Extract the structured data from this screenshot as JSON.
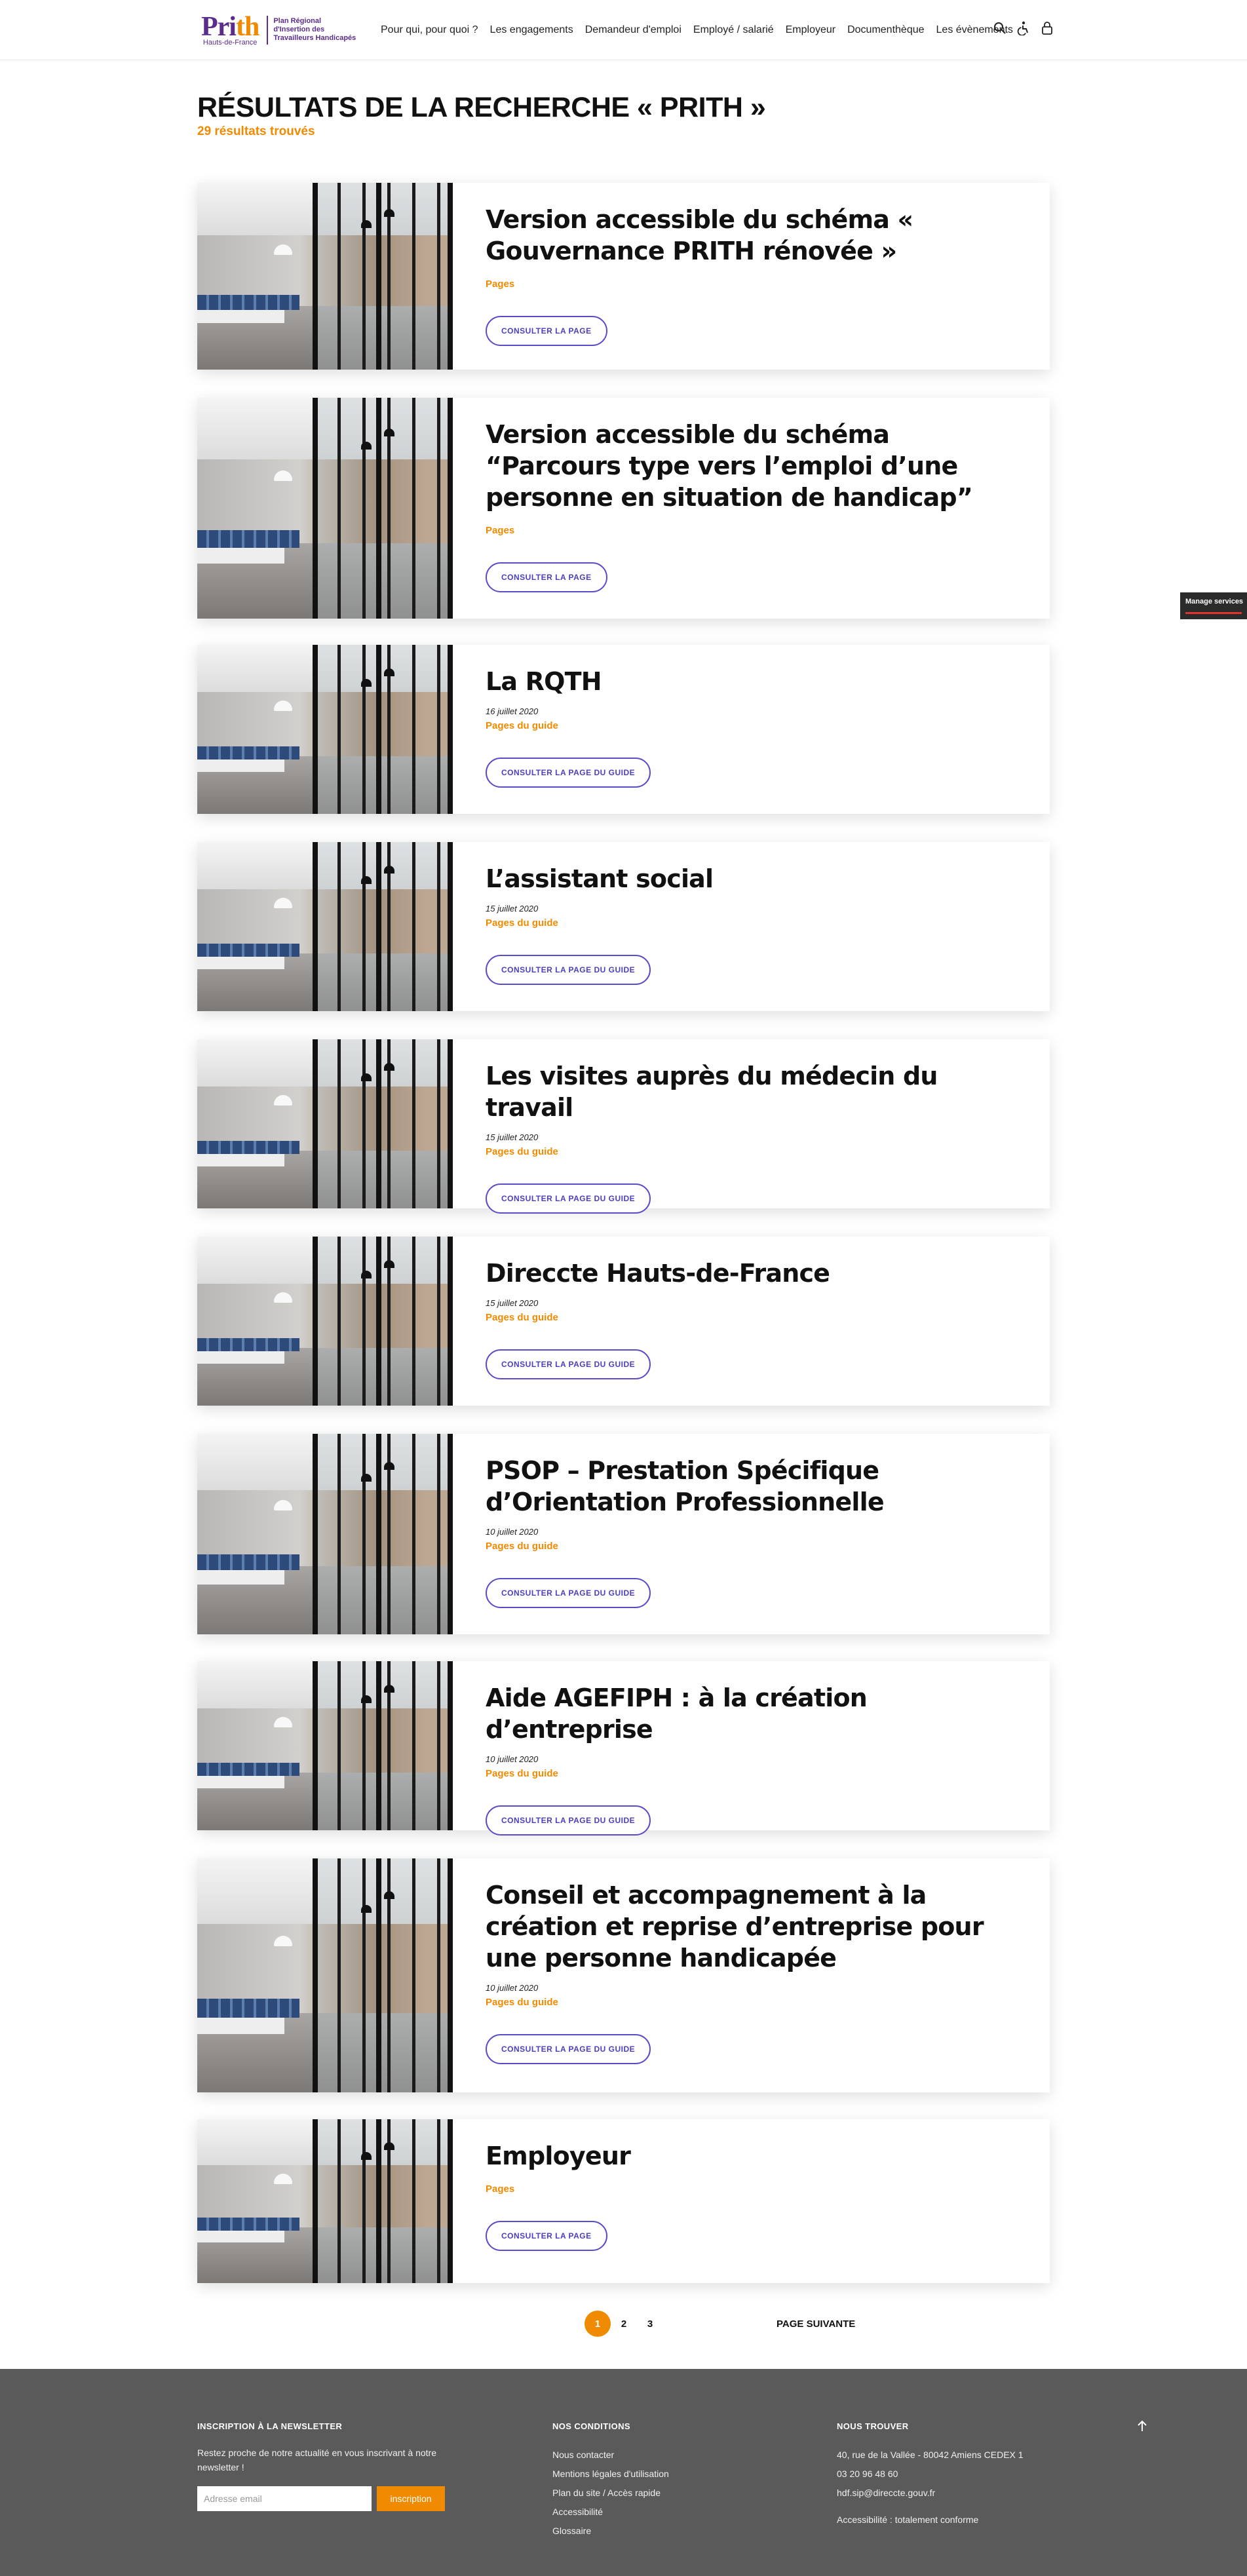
{
  "header": {
    "logo_text_a": "Pri",
    "logo_text_b": "th",
    "logo_sub": "Hauts-de-France",
    "logo_tagline_1": "Plan Régional",
    "logo_tagline_2": "d'Insertion des",
    "logo_tagline_3": "Travailleurs Handicapés",
    "nav": [
      "Pour qui, pour quoi ?",
      "Les engagements",
      "Demandeur d'emploi",
      "Employé / salarié",
      "Employeur",
      "Documenthèque",
      "Les évènements"
    ],
    "icons": [
      "search-icon",
      "accessibility-icon",
      "lock-icon"
    ]
  },
  "search": {
    "title": "RÉSULTATS DE LA RECHERCHE « PRITH »",
    "count": "29 résultats trouvés"
  },
  "results": [
    {
      "title": "Version accessible du schéma « Gouvernance PRITH rénovée »",
      "date": "",
      "type": "Pages",
      "button": "CONSULTER LA PAGE"
    },
    {
      "title": "Version accessible du schéma “Parcours type vers l’emploi d’une personne en situation de handicap”",
      "date": "",
      "type": "Pages",
      "button": "CONSULTER LA PAGE"
    },
    {
      "title": "La RQTH",
      "date": "16 juillet 2020",
      "type": "Pages du guide",
      "button": "CONSULTER LA PAGE DU GUIDE"
    },
    {
      "title": "L’assistant social",
      "date": "15 juillet 2020",
      "type": "Pages du guide",
      "button": "CONSULTER LA PAGE DU GUIDE"
    },
    {
      "title": "Les visites auprès du médecin du travail",
      "date": "15 juillet 2020",
      "type": "Pages du guide",
      "button": "CONSULTER LA PAGE DU GUIDE"
    },
    {
      "title": "Direccte Hauts-de-France",
      "date": "15 juillet 2020",
      "type": "Pages du guide",
      "button": "CONSULTER LA PAGE DU GUIDE"
    },
    {
      "title": "PSOP – Prestation Spécifique d’Orientation Professionnelle",
      "date": "10 juillet 2020",
      "type": "Pages du guide",
      "button": "CONSULTER LA PAGE DU GUIDE"
    },
    {
      "title": "Aide AGEFIPH : à la création d’entreprise",
      "date": "10 juillet 2020",
      "type": "Pages du guide",
      "button": "CONSULTER LA PAGE DU GUIDE"
    },
    {
      "title": "Conseil et accompagnement à la création et reprise d’entreprise pour une personne handicapée",
      "date": "10 juillet 2020",
      "type": "Pages du guide",
      "button": "CONSULTER LA PAGE DU GUIDE"
    },
    {
      "title": "Employeur",
      "date": "",
      "type": "Pages",
      "button": "CONSULTER LA PAGE"
    }
  ],
  "pagination": {
    "pages": [
      "1",
      "2",
      "3"
    ],
    "current": "1",
    "next_label": "PAGE SUIVANTE"
  },
  "manage_services": "Manage services",
  "footer": {
    "newsletter": {
      "heading": "INSCRIPTION À LA NEWSLETTER",
      "text": "Restez proche de notre actualité en vous inscrivant à notre newsletter !",
      "placeholder": "Adresse email",
      "button": "inscription"
    },
    "conditions": {
      "heading": "NOS CONDITIONS",
      "links": [
        "Nous contacter",
        "Mentions légales d'utilisation",
        "Plan du site / Accès rapide",
        "Accessibilité",
        "Glossaire"
      ]
    },
    "find_us": {
      "heading": "NOUS TROUVER",
      "address": "40, rue de la Vallée - 80042 Amiens CEDEX 1",
      "phone": "03 20 96 48 60",
      "email": "hdf.sip@direccte.gouv.fr",
      "accessibility": "Accessibilité : totalement conforme"
    }
  }
}
